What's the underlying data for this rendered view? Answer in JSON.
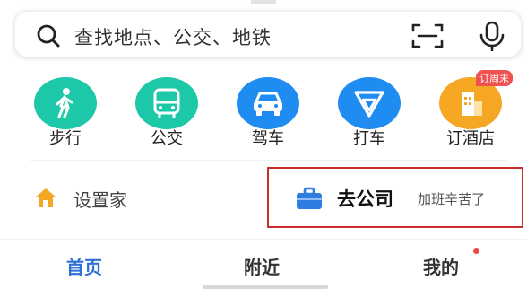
{
  "search": {
    "placeholder": "查找地点、公交、地铁",
    "icons": {
      "left": "search-icon",
      "scan": "scan-icon",
      "voice": "microphone-icon"
    }
  },
  "quick_actions": [
    {
      "label": "步行",
      "icon": "walking-person-icon",
      "color": "#1cc8a8"
    },
    {
      "label": "公交",
      "icon": "bus-icon",
      "color": "#1cc8a8"
    },
    {
      "label": "驾车",
      "icon": "car-icon",
      "color": "#1e8cf0"
    },
    {
      "label": "打车",
      "icon": "taxi-arrow-icon",
      "color": "#1e8cf0"
    },
    {
      "label": "订酒店",
      "icon": "hotel-building-icon",
      "color": "#f5a623",
      "badge": "订周末"
    }
  ],
  "shortcuts": {
    "home": {
      "label": "设置家",
      "icon": "house-icon",
      "color": "#f5a623"
    },
    "company": {
      "label": "去公司",
      "subtitle": "加班辛苦了",
      "icon": "briefcase-icon",
      "color": "#2f7de1"
    }
  },
  "tabs": [
    {
      "label": "首页",
      "active": true
    },
    {
      "label": "附近",
      "active": false
    },
    {
      "label": "我的",
      "active": false,
      "has_notification": true
    }
  ],
  "colors": {
    "accent": "#2f6fd6",
    "highlight_border": "#c9302c",
    "notification": "#f04747"
  }
}
